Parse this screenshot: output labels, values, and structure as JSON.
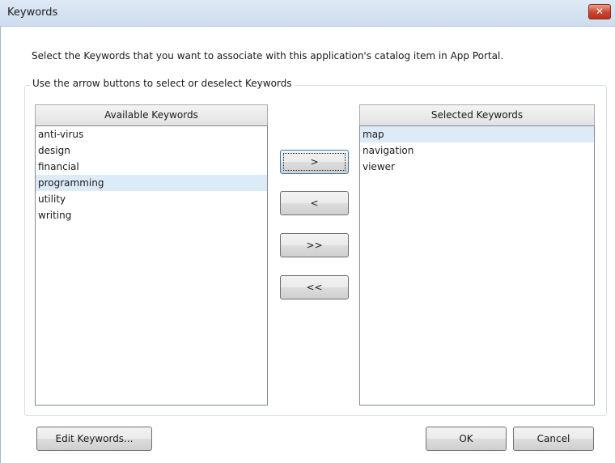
{
  "window": {
    "title": "Keywords",
    "close_label": "✕"
  },
  "instruction": "Select the Keywords that you want to associate with this application's catalog item in App Portal.",
  "group_label": "Use the arrow buttons to select or deselect Keywords",
  "available": {
    "header": "Available Keywords",
    "items": [
      "anti-virus",
      "design",
      "financial",
      "programming",
      "utility",
      "writing"
    ],
    "selected_item": "programming"
  },
  "selected": {
    "header": "Selected Keywords",
    "items": [
      "map",
      "navigation",
      "viewer"
    ],
    "selected_item": "map"
  },
  "transfer_buttons": {
    "add": ">",
    "remove": "<",
    "add_all": ">>",
    "remove_all": "<<"
  },
  "footer": {
    "edit_keywords": "Edit Keywords...",
    "ok": "OK",
    "cancel": "Cancel"
  }
}
